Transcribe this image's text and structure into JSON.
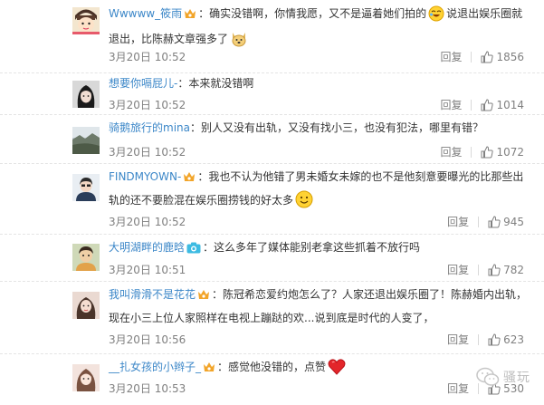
{
  "comments": [
    {
      "user": "Wwwww_筱雨",
      "text_a": "：确实没错啊，你情我愿，又不是逼着她们拍的",
      "text_b": "说退出娱乐圈就退出，比陈赫文章强多了",
      "time": "3月20日 10:52",
      "reply": "回复",
      "likes": "1856"
    },
    {
      "user": "想要你嗝屁儿-",
      "text_a": "：本来就没错啊",
      "time": "3月20日 10:52",
      "reply": "回复",
      "likes": "1014"
    },
    {
      "user": "骑鹅旅行的mina",
      "text_a": "：别人又没有出轨，又没有找小三，也没有犯法，哪里有错？",
      "time": "3月20日 10:52",
      "reply": "回复",
      "likes": "1072"
    },
    {
      "user": "FINDMYOWN-",
      "text_a": "：我也不认为他错了男未婚女未嫁的也不是他刻意要曝光的比那些出轨的还不要脸混在娱乐圈捞钱的好太多",
      "time": "3月20日 10:52",
      "reply": "回复",
      "likes": "945"
    },
    {
      "user": "大明湖畔的鹿晗",
      "text_a": "：这么多年了媒体能别老拿这些抓着不放行吗",
      "time": "3月20日 10:51",
      "reply": "回复",
      "likes": "782"
    },
    {
      "user": "我叫滑滑不是花花",
      "text_a": "：陈冠希恋爱约炮怎么了？人家还退出娱乐圈了！陈赫婚内出轨，现在小三上位人家照样在电视上蹦跶的欢...说到底是时代的人变了，",
      "time": "3月20日 10:56",
      "reply": "回复",
      "likes": "623"
    },
    {
      "user": "__扎女孩的小辫子_",
      "text_a": "：感觉他没错的，点赞",
      "time": "3月20日 10:53",
      "reply": "回复",
      "likes": "530"
    }
  ],
  "watermark": "骚玩"
}
